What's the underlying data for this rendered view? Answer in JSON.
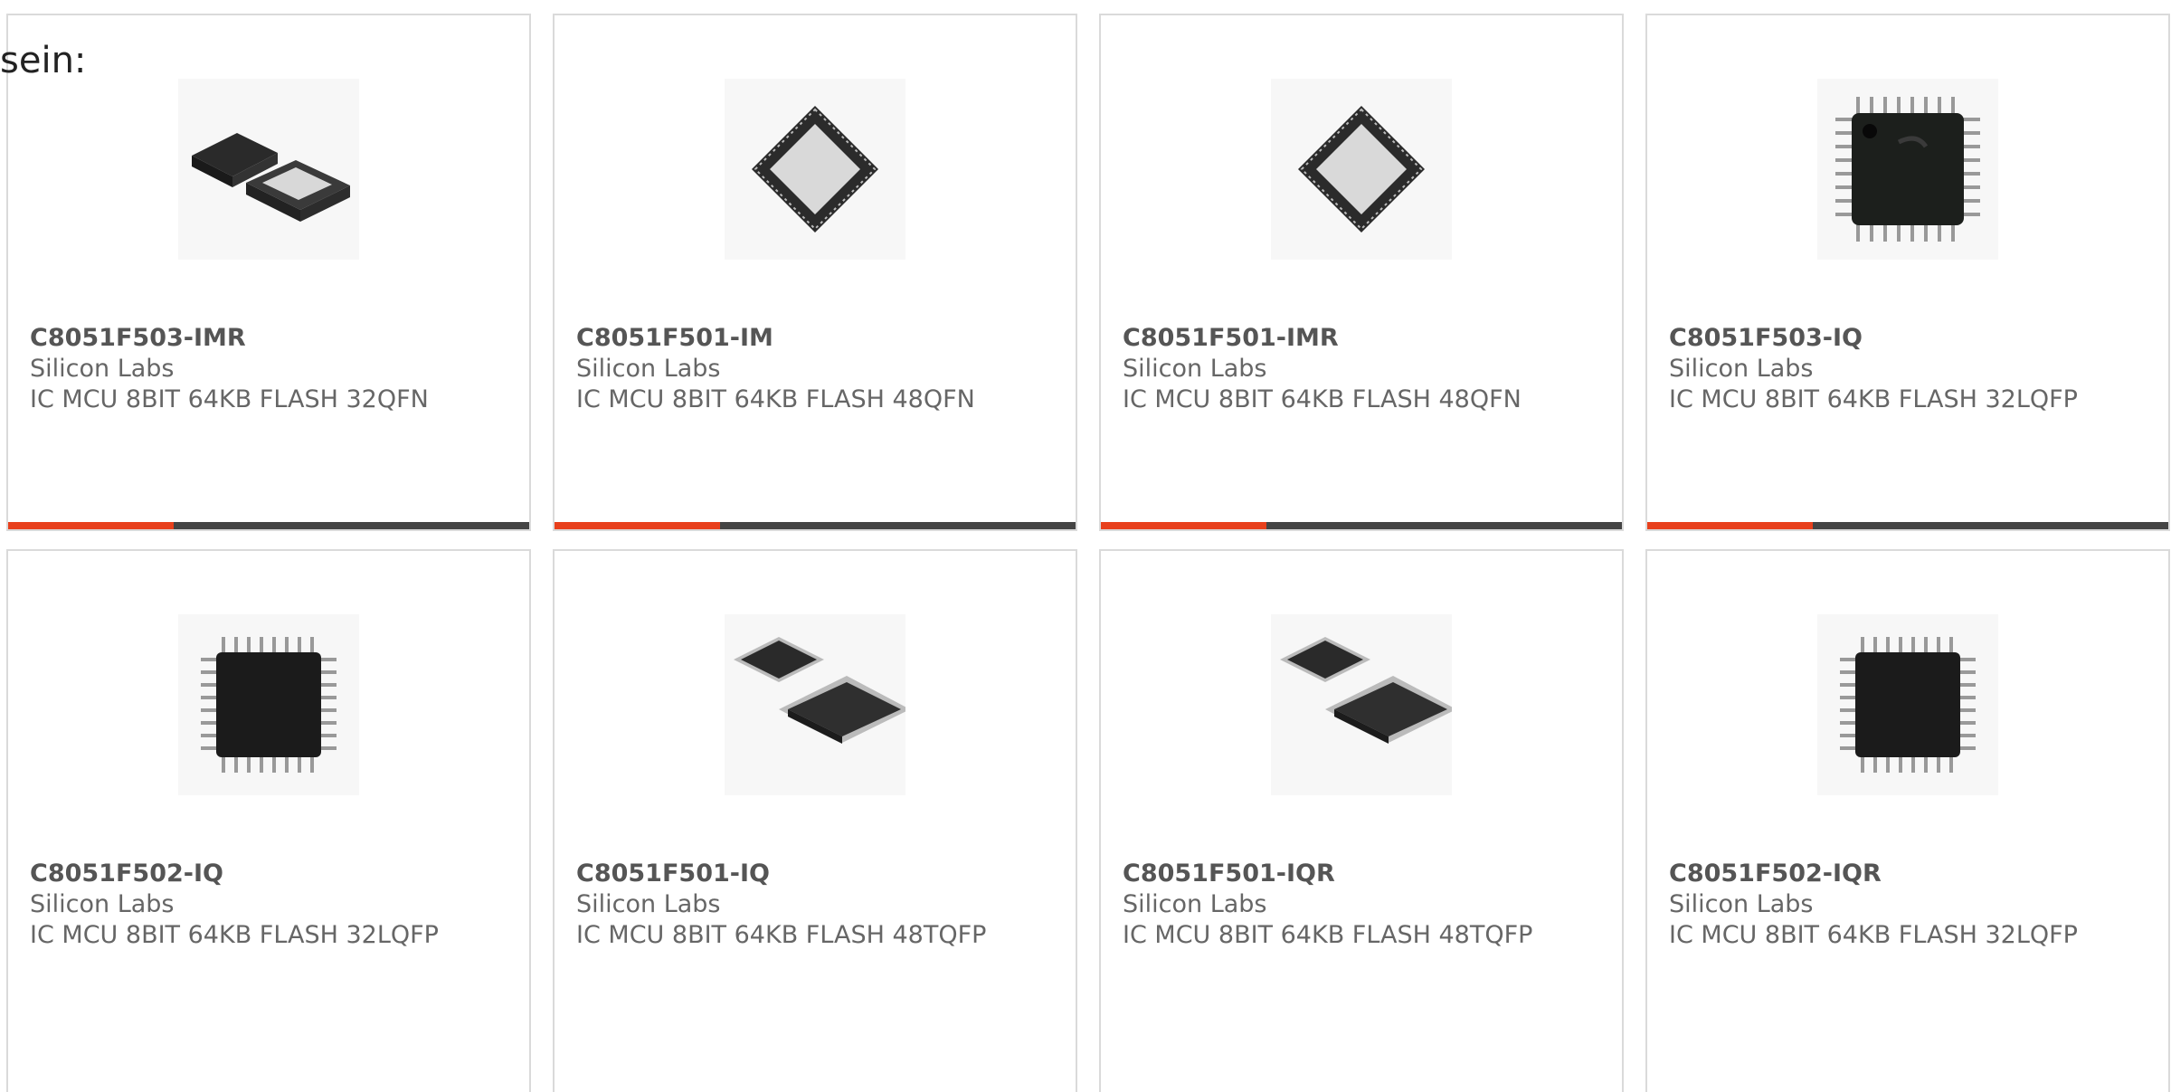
{
  "intro_text": "sein:",
  "colors": {
    "accent": "#e8401c",
    "bar": "#444444",
    "border": "#dadada",
    "text": "#666666"
  },
  "products": [
    {
      "part": "C8051F503-IMR",
      "maker": "Silicon Labs",
      "desc": "IC MCU 8BIT 64KB FLASH 32QFN",
      "image": "qfn-pair"
    },
    {
      "part": "C8051F501-IM",
      "maker": "Silicon Labs",
      "desc": "IC MCU 8BIT 64KB FLASH 48QFN",
      "image": "qfn-rotated"
    },
    {
      "part": "C8051F501-IMR",
      "maker": "Silicon Labs",
      "desc": "IC MCU 8BIT 64KB FLASH 48QFN",
      "image": "qfn-rotated"
    },
    {
      "part": "C8051F503-IQ",
      "maker": "Silicon Labs",
      "desc": "IC MCU 8BIT 64KB FLASH 32LQFP",
      "image": "lqfp-logo"
    },
    {
      "part": "C8051F502-IQ",
      "maker": "Silicon Labs",
      "desc": "IC MCU 8BIT 64KB FLASH 32LQFP",
      "image": "lqfp"
    },
    {
      "part": "C8051F501-IQ",
      "maker": "Silicon Labs",
      "desc": "IC MCU 8BIT 64KB FLASH 48TQFP",
      "image": "tqfp-pair"
    },
    {
      "part": "C8051F501-IQR",
      "maker": "Silicon Labs",
      "desc": "IC MCU 8BIT 64KB FLASH 48TQFP",
      "image": "tqfp-pair"
    },
    {
      "part": "C8051F502-IQR",
      "maker": "Silicon Labs",
      "desc": "IC MCU 8BIT 64KB FLASH 32LQFP",
      "image": "lqfp"
    }
  ]
}
